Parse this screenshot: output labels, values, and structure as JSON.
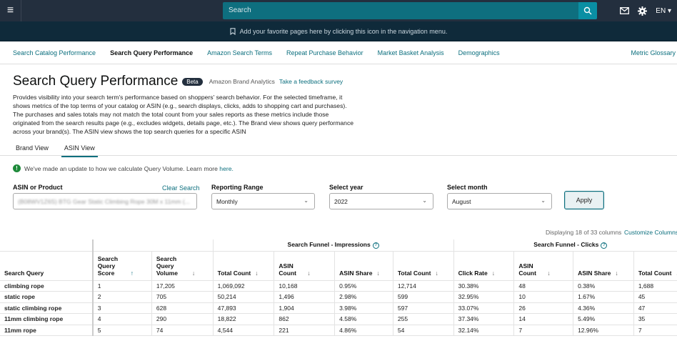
{
  "topbar": {
    "search_placeholder": "Search",
    "language": "EN ▾"
  },
  "favbar": {
    "message": "Add your favorite pages here by clicking this icon in the navigation menu."
  },
  "nav": {
    "items": [
      {
        "label": "Search Catalog Performance",
        "active": false
      },
      {
        "label": "Search Query Performance",
        "active": true
      },
      {
        "label": "Amazon Search Terms",
        "active": false
      },
      {
        "label": "Repeat Purchase Behavior",
        "active": false
      },
      {
        "label": "Market Basket Analysis",
        "active": false
      },
      {
        "label": "Demographics",
        "active": false
      }
    ],
    "metric_glossary": "Metric Glossary"
  },
  "header": {
    "title": "Search Query Performance",
    "badge": "Beta",
    "brand_analytics": "Amazon Brand Analytics",
    "feedback_link": "Take a feedback survey",
    "description": "Provides visibility into your search term's performance based on shoppers' search behavior. For the selected timeframe, it shows metrics of the top terms of your catalog or ASIN (e.g., search displays, clicks, adds to shopping cart and purchases). The purchases and sales totals may not match the total count from your sales reports as these metrics include those originated from the search results page (e.g., excludes widgets, details page, etc.). The Brand view shows query performance across your brand(s). The ASIN view shows the top search queries for a specific ASIN"
  },
  "view_tabs": {
    "brand": "Brand View",
    "asin": "ASIN View"
  },
  "notice": {
    "text": "We've made an update to how we calculate Query Volume. Learn more ",
    "link": "here."
  },
  "filters": {
    "asin_label": "ASIN or Product",
    "clear_search": "Clear Search",
    "asin_value": "(B08WV1Z6S) BTG Gear Static Climbing Rope 30M x 11mm (...",
    "range_label": "Reporting Range",
    "range_value": "Monthly",
    "year_label": "Select year",
    "year_value": "2022",
    "month_label": "Select month",
    "month_value": "August",
    "apply": "Apply"
  },
  "table_meta": {
    "displaying": "Displaying 18 of 33 columns",
    "customize": "Customize Columns"
  },
  "table": {
    "groups": {
      "impressions": "Search Funnel - Impressions",
      "clicks": "Search Funnel - Clicks"
    },
    "headers": {
      "query": "Search Query",
      "score": "Search Query Score",
      "volume": "Search Query Volume",
      "imp_total": "Total Count",
      "imp_asin": "ASIN Count",
      "imp_share": "ASIN Share",
      "clk_total": "Total Count",
      "clk_rate": "Click Rate",
      "clk_asin": "ASIN Count",
      "clk_share": "ASIN Share",
      "next_total": "Total Count"
    },
    "rows": [
      [
        "climbing rope",
        "1",
        "17,205",
        "1,069,092",
        "10,168",
        "0.95%",
        "12,714",
        "30.38%",
        "48",
        "0.38%",
        "1,688"
      ],
      [
        "static rope",
        "2",
        "705",
        "50,214",
        "1,496",
        "2.98%",
        "599",
        "32.95%",
        "10",
        "1.67%",
        "45"
      ],
      [
        "static climbing rope",
        "3",
        "628",
        "47,893",
        "1,904",
        "3.98%",
        "597",
        "33.07%",
        "26",
        "4.36%",
        "47"
      ],
      [
        "11mm climbing rope",
        "4",
        "290",
        "18,822",
        "862",
        "4.58%",
        "255",
        "37.34%",
        "14",
        "5.49%",
        "35"
      ],
      [
        "11mm rope",
        "5",
        "74",
        "4,544",
        "221",
        "4.86%",
        "54",
        "32.14%",
        "7",
        "12.96%",
        "7"
      ]
    ]
  },
  "colors": {
    "topbar": "#232f3e",
    "search": "#0e6f7f",
    "favbar": "#0f2a3a",
    "link": "#0c6f7e",
    "notice": "#1e8a3a"
  }
}
